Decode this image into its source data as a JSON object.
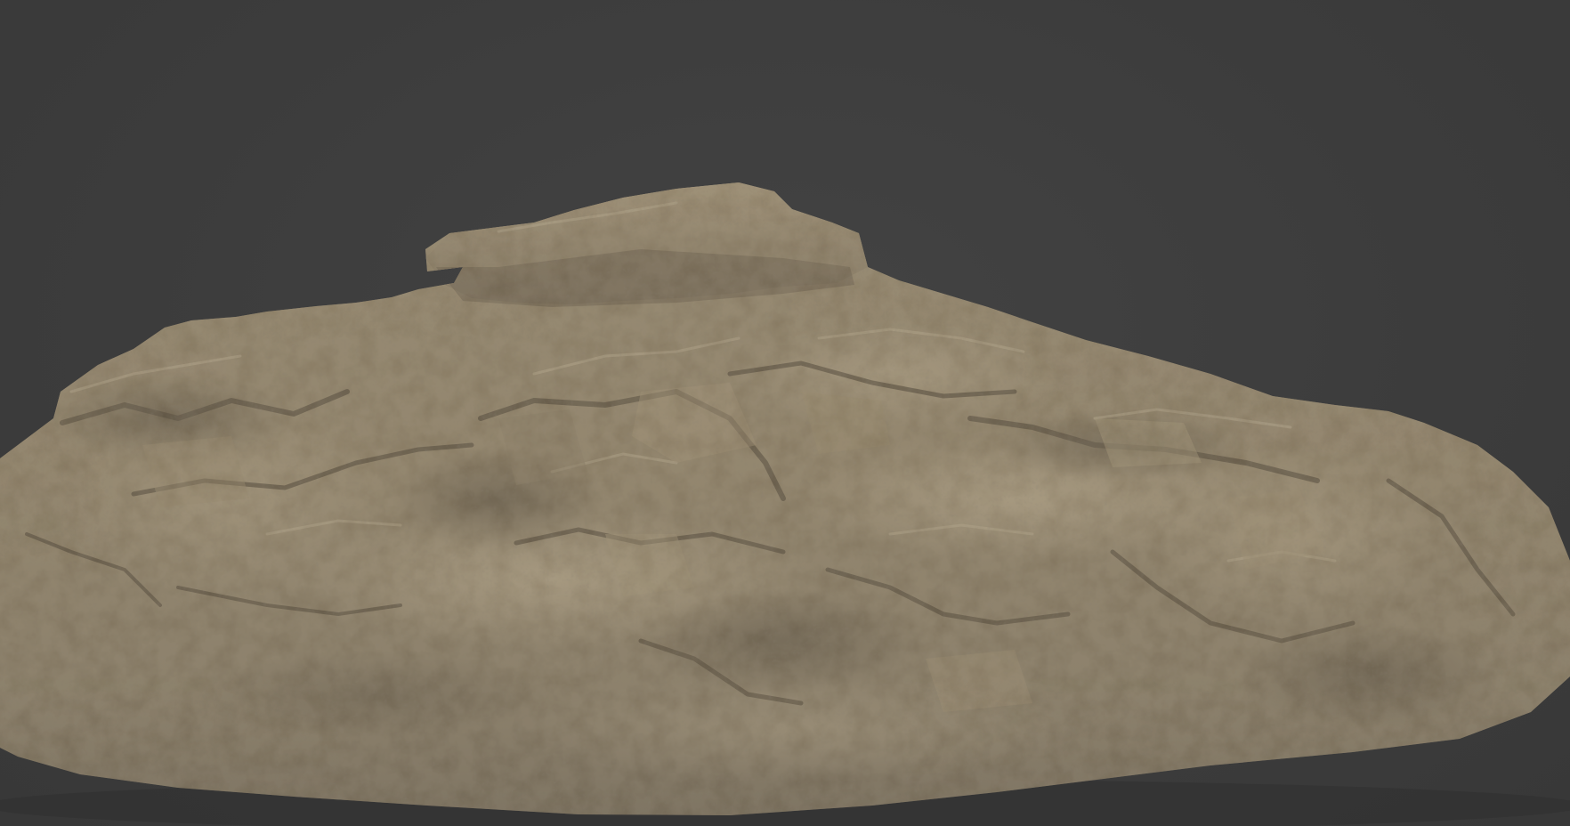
{
  "viewport": {
    "background_color": "#3d3d3d"
  },
  "model": {
    "subject": "rock",
    "colors": {
      "base": "#8a7f6a",
      "highlight": "#c2b396",
      "mid": "#9c8e74",
      "shadow": "#4e463a",
      "deep_shadow": "#332d25",
      "tint_warm": "#a08a6a",
      "tint_cool": "#8d8a86"
    }
  }
}
